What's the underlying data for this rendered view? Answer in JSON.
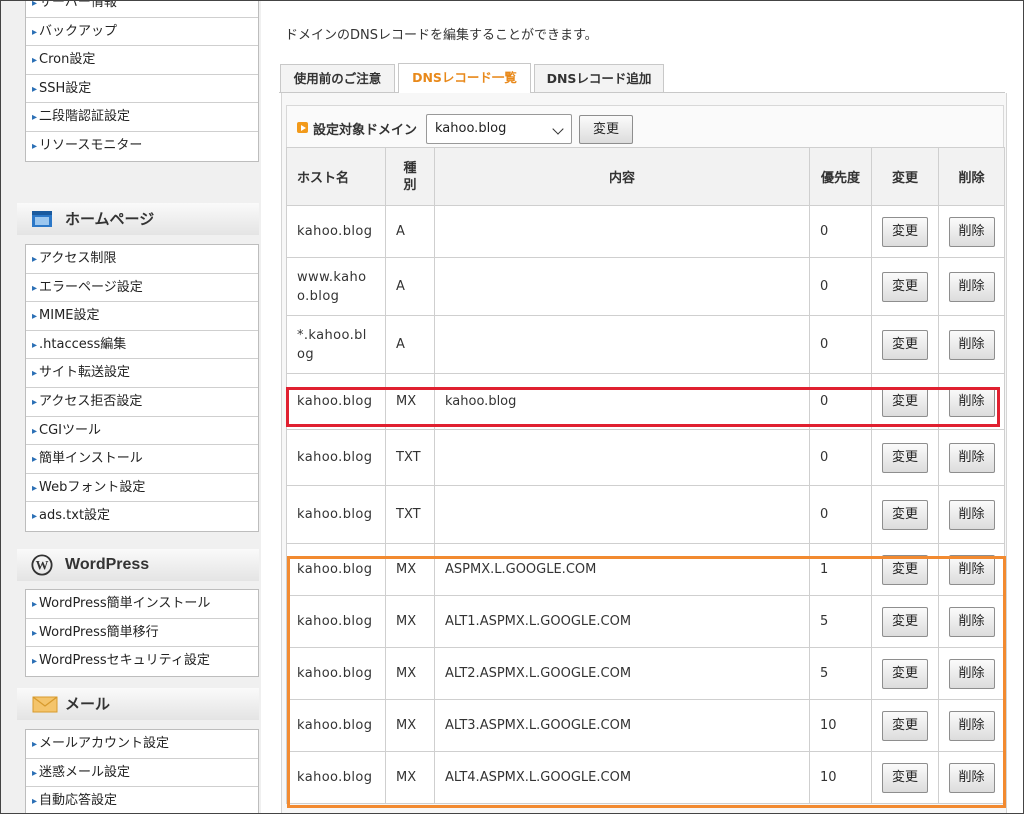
{
  "sidebar": {
    "group1": [
      "サーバー情報",
      "バックアップ",
      "Cron設定",
      "SSH設定",
      "二段階認証設定",
      "リソースモニター"
    ],
    "homepage": {
      "title": "ホームページ",
      "items": [
        "アクセス制限",
        "エラーページ設定",
        "MIME設定",
        ".htaccess編集",
        "サイト転送設定",
        "アクセス拒否設定",
        "CGIツール",
        "簡単インストール",
        "Webフォント設定",
        "ads.txt設定"
      ]
    },
    "wordpress": {
      "title": "WordPress",
      "items": [
        "WordPress簡単インストール",
        "WordPress簡単移行",
        "WordPressセキュリティ設定"
      ]
    },
    "mail": {
      "title": "メール",
      "items": [
        "メールアカウント設定",
        "迷惑メール設定",
        "自動応答設定"
      ]
    }
  },
  "main": {
    "intro": "ドメインのDNSレコードを編集することができます。",
    "tabs": [
      "使用前のご注意",
      "DNSレコード一覧",
      "DNSレコード追加"
    ],
    "domain": {
      "label": "設定対象ドメイン",
      "selected": "kahoo.blog",
      "button": "変更"
    }
  },
  "table": {
    "headers": {
      "host": "ホスト名",
      "type": "種\n別",
      "content": "内容",
      "priority": "優先度",
      "edit": "変更",
      "delete": "削除"
    },
    "rows": [
      {
        "host": "kahoo.blog",
        "type": "A",
        "content": "",
        "priority": "0",
        "edit": "変更",
        "delete": "削除"
      },
      {
        "host": "www.kaho\no.blog",
        "type": "A",
        "content": "",
        "priority": "0",
        "edit": "変更",
        "delete": "削除"
      },
      {
        "host": "*.kahoo.bl\nog",
        "type": "A",
        "content": "",
        "priority": "0",
        "edit": "変更",
        "delete": "削除"
      },
      {
        "host": "kahoo.blog",
        "type": "MX",
        "content": "kahoo.blog",
        "priority": "0",
        "edit": "変更",
        "delete": "削除"
      },
      {
        "host": "kahoo.blog",
        "type": "TXT",
        "content": "",
        "priority": "0",
        "edit": "変更",
        "delete": "削除"
      },
      {
        "host": "kahoo.blog",
        "type": "TXT",
        "content": "",
        "priority": "0",
        "edit": "変更",
        "delete": "削除"
      },
      {
        "host": "kahoo.blog",
        "type": "MX",
        "content": "ASPMX.L.GOOGLE.COM",
        "priority": "1",
        "edit": "変更",
        "delete": "削除"
      },
      {
        "host": "kahoo.blog",
        "type": "MX",
        "content": "ALT1.ASPMX.L.GOOGLE.COM",
        "priority": "5",
        "edit": "変更",
        "delete": "削除"
      },
      {
        "host": "kahoo.blog",
        "type": "MX",
        "content": "ALT2.ASPMX.L.GOOGLE.COM",
        "priority": "5",
        "edit": "変更",
        "delete": "削除"
      },
      {
        "host": "kahoo.blog",
        "type": "MX",
        "content": "ALT3.ASPMX.L.GOOGLE.COM",
        "priority": "10",
        "edit": "変更",
        "delete": "削除"
      },
      {
        "host": "kahoo.blog",
        "type": "MX",
        "content": "ALT4.ASPMX.L.GOOGLE.COM",
        "priority": "10",
        "edit": "変更",
        "delete": "削除"
      }
    ]
  },
  "colors": {
    "accent": "#e8891b",
    "highlight_red": "#e02030",
    "highlight_orange": "#f28a30"
  }
}
